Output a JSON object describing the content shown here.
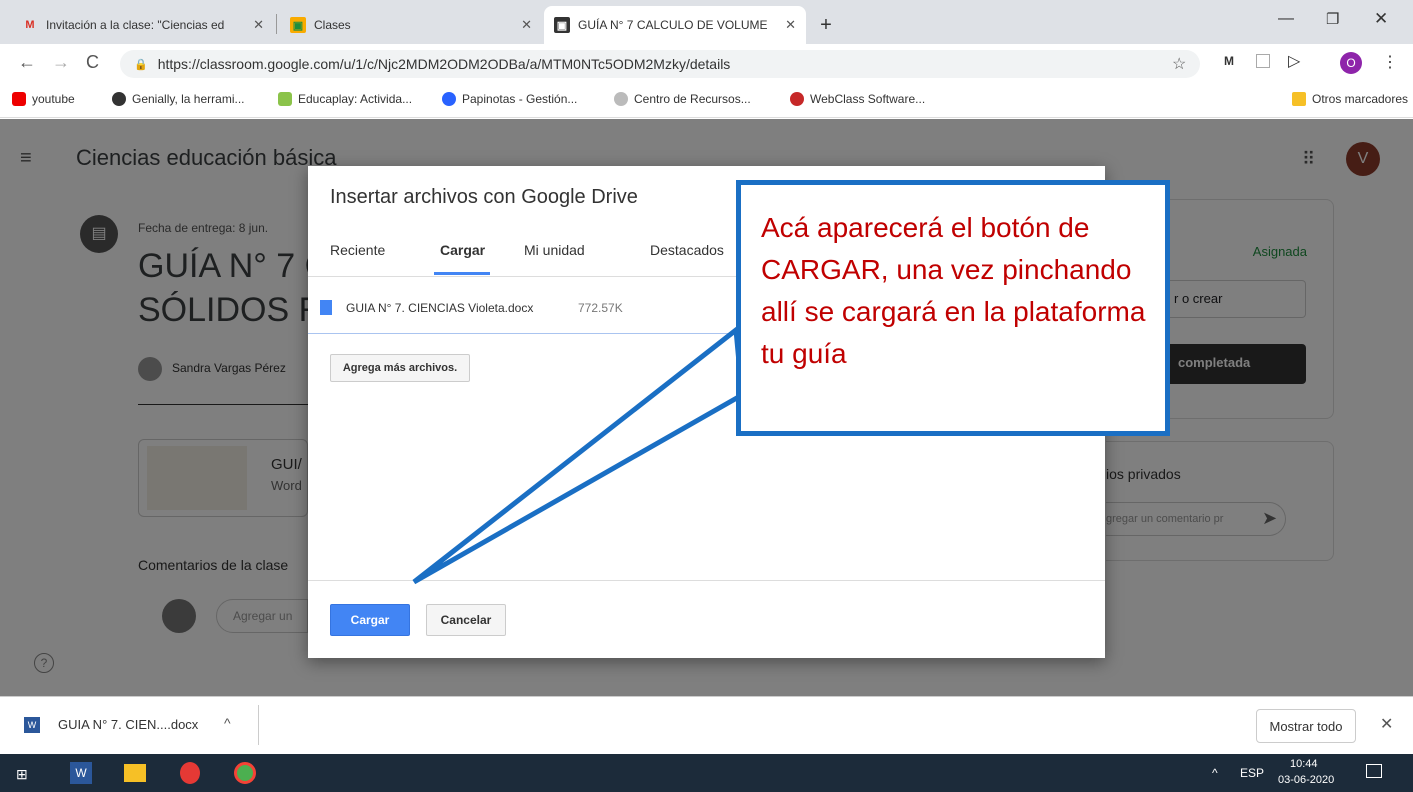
{
  "tabs": [
    {
      "label": "Invitación a la clase: \"Ciencias ed",
      "icon": "gmail-icon"
    },
    {
      "label": "Clases",
      "icon": "classroom-icon"
    },
    {
      "label": "GUÍA N° 7 CALCULO DE VOLUME",
      "icon": "classroom-icon"
    }
  ],
  "address": {
    "url": "https://classroom.google.com/u/1/c/Njc2MDM2ODM2ODBa/a/MTM0NTc5ODM2Mzky/details"
  },
  "bookmarks": [
    "youtube",
    "Genially, la herrami...",
    "Educaplay: Activida...",
    "Papinotas - Gestión...",
    "Centro de Recursos...",
    "WebClass Software..."
  ],
  "other_bookmarks": "Otros marcadores",
  "profile_initial": "O",
  "classroom": {
    "class_name": "Ciencias educación básica",
    "avatar_initial": "V",
    "due_date": "Fecha de entrega: 8 jun.",
    "title_line1": "GUÍA N° 7 C",
    "title_line2": "SÓLIDOS R",
    "author": "Sandra Vargas Pérez",
    "attachment_title": "GUI/",
    "attachment_sub": "Word",
    "class_comments": "Comentarios de la clase",
    "comment_placeholder": "Agregar un",
    "status": "Asignada",
    "add_create": "r o crear",
    "mark_done": "completada",
    "private_comments": "ios privados",
    "private_placeholder": "gregar un comentario pr"
  },
  "dialog": {
    "title": "Insertar archivos con Google Drive",
    "tabs": [
      "Reciente",
      "Cargar",
      "Mi unidad",
      "Destacados"
    ],
    "active_tab": "Cargar",
    "file_name": "GUIA N° 7. CIENCIAS Violeta.docx",
    "file_size": "772.57K",
    "add_more": "Agrega más archivos.",
    "upload_button": "Cargar",
    "cancel_button": "Cancelar"
  },
  "callout": {
    "text": "Acá aparecerá el botón de CARGAR, una vez pinchando allí se cargará en la plataforma tu guía"
  },
  "download": {
    "file": "GUIA N° 7. CIEN....docx",
    "show_all": "Mostrar todo"
  },
  "taskbar": {
    "lang": "ESP",
    "time": "10:44",
    "date": "03-06-2020"
  },
  "colors": {
    "callout_border": "#1a6fc4",
    "callout_text": "#c00000",
    "primary": "#4285f4"
  }
}
